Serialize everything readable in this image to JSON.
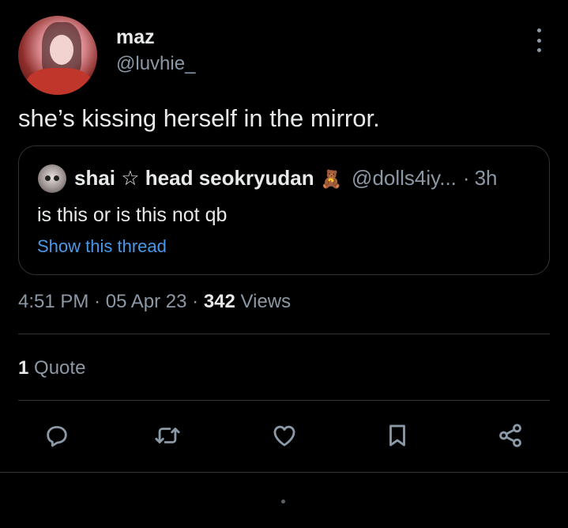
{
  "author": {
    "display_name": "maz",
    "handle": "@luvhie_"
  },
  "tweet": {
    "text": "she’s kissing herself in the mirror."
  },
  "quoted_tweet": {
    "name": "shai ☆ head seokryudan",
    "emoji": "🧸",
    "handle": "@dolls4iy...",
    "separator": "·",
    "time": "3h",
    "text": "is this or is this not qb",
    "show_thread": "Show this thread"
  },
  "meta": {
    "time": "4:51 PM",
    "sep1": "·",
    "date": "05 Apr 23",
    "sep2": "·",
    "views_count": "342",
    "views_label": "Views"
  },
  "stats": {
    "quote_count": "1",
    "quote_label": "Quote"
  },
  "actions": [
    "reply-icon",
    "retweet-icon",
    "like-icon",
    "bookmark-icon",
    "share-icon"
  ],
  "colors": {
    "background": "#000000",
    "text": "#e7e9ea",
    "secondary": "#8b98a5",
    "link": "#4a99e9",
    "border": "#2f3336"
  }
}
